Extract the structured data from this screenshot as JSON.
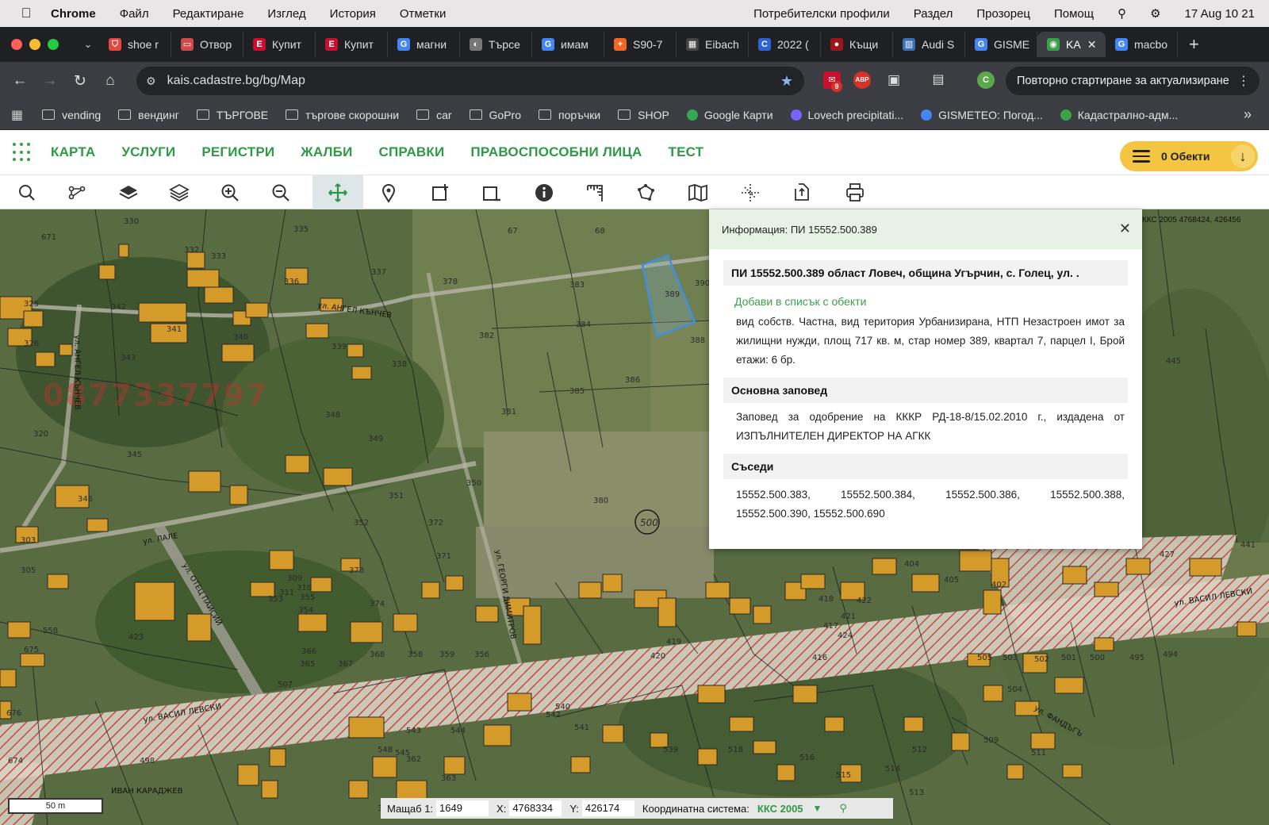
{
  "menubar": {
    "apple": "",
    "app": "Chrome",
    "items": [
      "Файл",
      "Редактиране",
      "Изглед",
      "История",
      "Отметки"
    ],
    "right_items": [
      "Потребителски профили",
      "Раздел",
      "Прозорец",
      "Помощ"
    ],
    "clock": "17 Aug  10 21"
  },
  "tabs": [
    {
      "label": "shoe r",
      "color": "#e8463c",
      "glyph": "⛉"
    },
    {
      "label": "Отвор",
      "color": "#d14a4a",
      "glyph": "▭"
    },
    {
      "label": "Купит",
      "color": "#c8102e",
      "glyph": "E"
    },
    {
      "label": "Купит",
      "color": "#c8102e",
      "glyph": "E"
    },
    {
      "label": "магни",
      "color": "#4285f4",
      "glyph": "G"
    },
    {
      "label": "Търсе",
      "color": "#777777",
      "glyph": "◐"
    },
    {
      "label": "имам",
      "color": "#4285f4",
      "glyph": "G"
    },
    {
      "label": "S90-7",
      "color": "#f26522",
      "glyph": "+"
    },
    {
      "label": "Eibach",
      "color": "#444444",
      "glyph": "▦"
    },
    {
      "label": "2022 (",
      "color": "#2b63d6",
      "glyph": "C"
    },
    {
      "label": "Къщи",
      "color": "#a0151b",
      "glyph": "●"
    },
    {
      "label": "Audi S",
      "color": "#3b6fb6",
      "glyph": "▥"
    },
    {
      "label": "GISME",
      "color": "#4285f4",
      "glyph": "G"
    },
    {
      "label": "KA",
      "color": "#3aa04a",
      "glyph": "◉",
      "active": true
    },
    {
      "label": "macbo",
      "color": "#4285f4",
      "glyph": "G"
    }
  ],
  "addressbar": {
    "url": "kais.cadastre.bg/bg/Map",
    "update_label": "Повторно стартиране за актуализиране",
    "ext_badge": "9",
    "profile_initial": "C"
  },
  "bookmarks": [
    {
      "label": "vending",
      "type": "folder"
    },
    {
      "label": "вендинг",
      "type": "folder"
    },
    {
      "label": "ТЪРГОВЕ",
      "type": "folder"
    },
    {
      "label": "търгове скорошни",
      "type": "folder"
    },
    {
      "label": "car",
      "type": "folder"
    },
    {
      "label": "GoPro",
      "type": "folder"
    },
    {
      "label": "поръчки",
      "type": "folder"
    },
    {
      "label": "SHOP",
      "type": "folder"
    },
    {
      "label": "Google Карти",
      "type": "link",
      "color": "#34a853"
    },
    {
      "label": "Lovech precipitati...",
      "type": "link",
      "color": "#7b61ff"
    },
    {
      "label": "GISMETEO: Погод...",
      "type": "link",
      "color": "#4285f4"
    },
    {
      "label": "Кадастрално-адм...",
      "type": "link",
      "color": "#3aa04a"
    }
  ],
  "site_nav": [
    "КАРТА",
    "УСЛУГИ",
    "РЕГИСТРИ",
    "ЖАЛБИ",
    "СПРАВКИ",
    "ПРАВОСПОСОБНИ ЛИЦА",
    "ТЕСТ"
  ],
  "objects_label": "0 Обекти",
  "map_tools": [
    "search-tool",
    "tree-tool",
    "layer-tool",
    "layers-tool",
    "zoom-in-tool",
    "zoom-out-tool",
    "pan-tool",
    "marker-tool",
    "select-add-tool",
    "select-remove-tool",
    "info-tool",
    "measure-tool",
    "polygon-tool",
    "map-tool",
    "coords-tool",
    "export-tool",
    "print-tool"
  ],
  "active_tool": "pan-tool",
  "info": {
    "header": "Информация: ПИ 15552.500.389",
    "title": "ПИ 15552.500.389 област Ловеч, община Угърчин, с. Голец, ул. .",
    "add_link": "Добави в списък с обекти",
    "description": "вид собств. Частна, вид територия Урбанизирана, НТП Незастроен имот за жилищни нужди, площ 717 кв. м, стар номер 389, квартал 7, парцел I, Брой етажи: 6 бр.",
    "order_title": "Основна заповед",
    "order_text": "Заповед за одобрение на КККР РД-18-8/15.02.2010 г., издадена от ИЗПЪЛНИТЕЛЕН ДИРЕКТОР НА АГКК",
    "neighbors_title": "Съседи",
    "neighbors": [
      "15552.500.383,",
      "15552.500.384,",
      "15552.500.386,",
      "15552.500.388,",
      "15552.500.390,",
      "15552.500.690"
    ]
  },
  "map_corner_text": "ККС 2005 4768424, 426456",
  "map": {
    "quarter_label": "500",
    "parcel_numbers": [
      "335",
      "336",
      "337",
      "378",
      "383",
      "389",
      "390",
      "384",
      "382",
      "388",
      "338",
      "386",
      "385",
      "381",
      "349",
      "348",
      "350",
      "351",
      "352",
      "372",
      "371",
      "380",
      "373",
      "374",
      "345",
      "346",
      "320",
      "326",
      "325",
      "342",
      "343",
      "341",
      "340",
      "339",
      "332",
      "333",
      "330",
      "671",
      "67",
      "68",
      "445",
      "441",
      "427",
      "402",
      "405",
      "404",
      "418",
      "417",
      "416",
      "421",
      "422",
      "424",
      "420",
      "419",
      "503",
      "502",
      "501",
      "500",
      "495",
      "494",
      "505",
      "504",
      "509",
      "511",
      "512",
      "513",
      "514",
      "515",
      "516",
      "518",
      "539",
      "540",
      "541",
      "542",
      "543",
      "544",
      "545",
      "548",
      "362",
      "363",
      "364",
      "365",
      "366",
      "367",
      "368",
      "358",
      "359",
      "356",
      "355",
      "354",
      "353",
      "311",
      "310",
      "309",
      "303",
      "305",
      "423",
      "558",
      "675",
      "676",
      "674",
      "498",
      "507"
    ],
    "street_labels": [
      "ул. АНГЕЛ КЪНЧЕВ",
      "ул. ВАСИЛ ЛЕВСКИ",
      "ул. ВАСИЛ ЛЕВСКИ",
      "ул. ОТЕЦ ПАИСИЙ",
      "ул. ГЕОРГИ ДИМИТРОВ",
      "ул. ЛАЛЕ",
      "ул. АНГЕЛ КЪНЧЕВ",
      "ул. ФАНДЪГЪ",
      "ИВАН КАРАДЖЕВ"
    ],
    "watermark": "0877337797"
  },
  "bottom": {
    "scale": "50 m",
    "scale_label": "Мащаб 1:",
    "scale_value": "1649",
    "x_label": "X:",
    "x_value": "4768334",
    "y_label": "Y:",
    "y_value": "426174",
    "crs_label": "Координатна система:",
    "crs_value": "ККС 2005"
  }
}
